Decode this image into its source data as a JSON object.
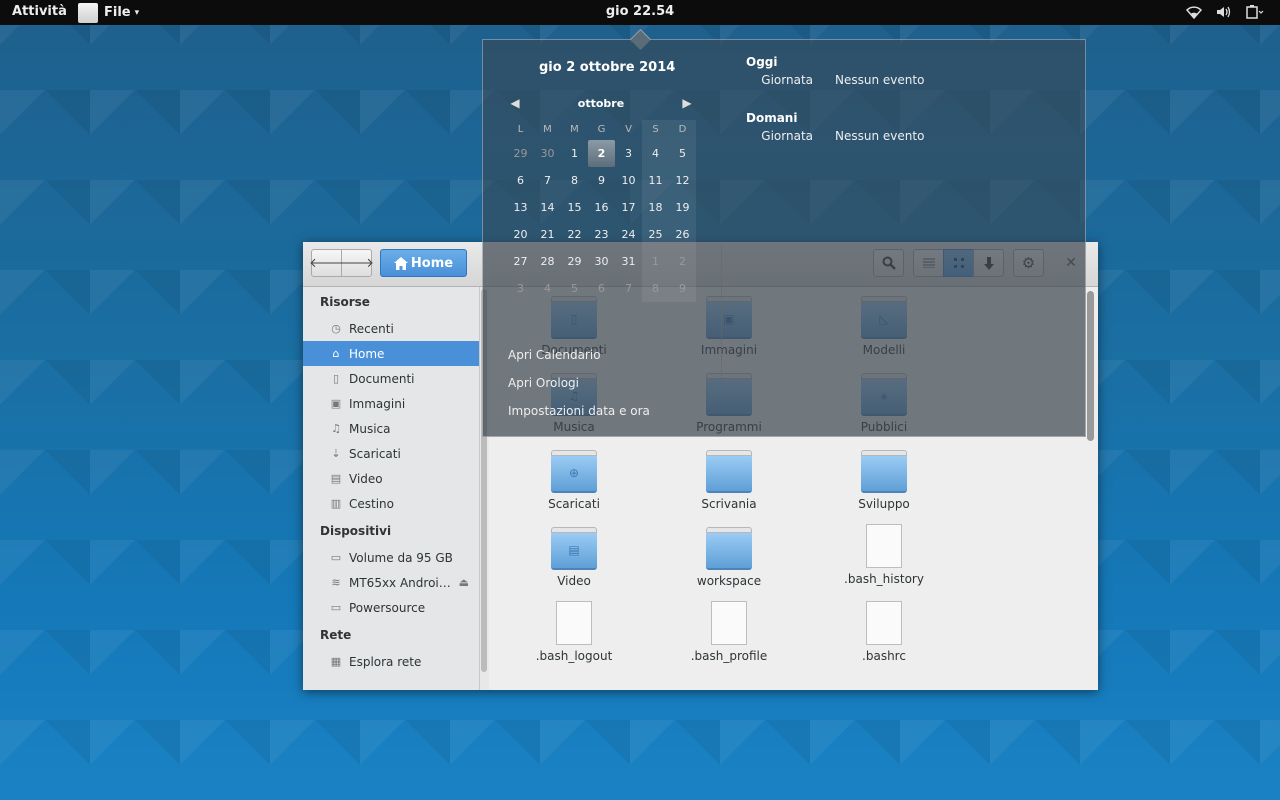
{
  "topbar": {
    "activities": "Attività",
    "app_menu": "File",
    "clock": "gio 22.54"
  },
  "calendar": {
    "date_title": "gio  2 ottobre 2014",
    "month": "ottobre",
    "weekdays": [
      "L",
      "M",
      "M",
      "G",
      "V",
      "S",
      "D"
    ],
    "weeks": [
      [
        "29",
        "30",
        "1",
        "2",
        "3",
        "4",
        "5"
      ],
      [
        "6",
        "7",
        "8",
        "9",
        "10",
        "11",
        "12"
      ],
      [
        "13",
        "14",
        "15",
        "16",
        "17",
        "18",
        "19"
      ],
      [
        "20",
        "21",
        "22",
        "23",
        "24",
        "25",
        "26"
      ],
      [
        "27",
        "28",
        "29",
        "30",
        "31",
        "1",
        "2"
      ],
      [
        "3",
        "4",
        "5",
        "6",
        "7",
        "8",
        "9"
      ]
    ],
    "today": "2",
    "events": [
      {
        "day": "Oggi",
        "time": "Giornata",
        "text": "Nessun evento"
      },
      {
        "day": "Domani",
        "time": "Giornata",
        "text": "Nessun evento"
      }
    ],
    "links": [
      "Apri Calendario",
      "Apri Orologi",
      "Impostazioni data e ora"
    ]
  },
  "files": {
    "location": "Home",
    "sidebar": {
      "sections": [
        {
          "title": "Risorse",
          "items": [
            {
              "label": "Recenti",
              "icon": "clock-icon"
            },
            {
              "label": "Home",
              "icon": "home-icon",
              "active": true
            },
            {
              "label": "Documenti",
              "icon": "document-icon"
            },
            {
              "label": "Immagini",
              "icon": "image-icon"
            },
            {
              "label": "Musica",
              "icon": "music-icon"
            },
            {
              "label": "Scaricati",
              "icon": "download-icon"
            },
            {
              "label": "Video",
              "icon": "video-icon"
            },
            {
              "label": "Cestino",
              "icon": "trash-icon"
            }
          ]
        },
        {
          "title": "Dispositivi",
          "items": [
            {
              "label": "Volume da 95 GB",
              "icon": "drive-icon"
            },
            {
              "label": "MT65xx Androi…",
              "icon": "phone-icon",
              "eject": true
            },
            {
              "label": "Powersource",
              "icon": "drive-icon"
            }
          ]
        },
        {
          "title": "Rete",
          "items": [
            {
              "label": "Esplora rete",
              "icon": "network-icon"
            }
          ]
        }
      ]
    },
    "items": [
      {
        "name": "Documenti",
        "kind": "folder",
        "emblem": "▯"
      },
      {
        "name": "Immagini",
        "kind": "folder",
        "emblem": "▣"
      },
      {
        "name": "Modelli",
        "kind": "folder",
        "emblem": "◺"
      },
      {
        "name": "Musica",
        "kind": "folder",
        "emblem": "♫"
      },
      {
        "name": "Programmi",
        "kind": "folder",
        "emblem": ""
      },
      {
        "name": "Pubblici",
        "kind": "folder",
        "emblem": "⚹"
      },
      {
        "name": "Scaricati",
        "kind": "folder",
        "emblem": "⊕"
      },
      {
        "name": "Scrivania",
        "kind": "folder",
        "emblem": ""
      },
      {
        "name": "Sviluppo",
        "kind": "folder",
        "emblem": ""
      },
      {
        "name": "Video",
        "kind": "folder",
        "emblem": "▤"
      },
      {
        "name": "workspace",
        "kind": "folder",
        "emblem": ""
      },
      {
        "name": ".bash_history",
        "kind": "file",
        "emblem": ""
      },
      {
        "name": ".bash_logout",
        "kind": "file",
        "emblem": ""
      },
      {
        "name": ".bash_profile",
        "kind": "file",
        "emblem": ""
      },
      {
        "name": ".bashrc",
        "kind": "file",
        "emblem": ""
      }
    ]
  }
}
